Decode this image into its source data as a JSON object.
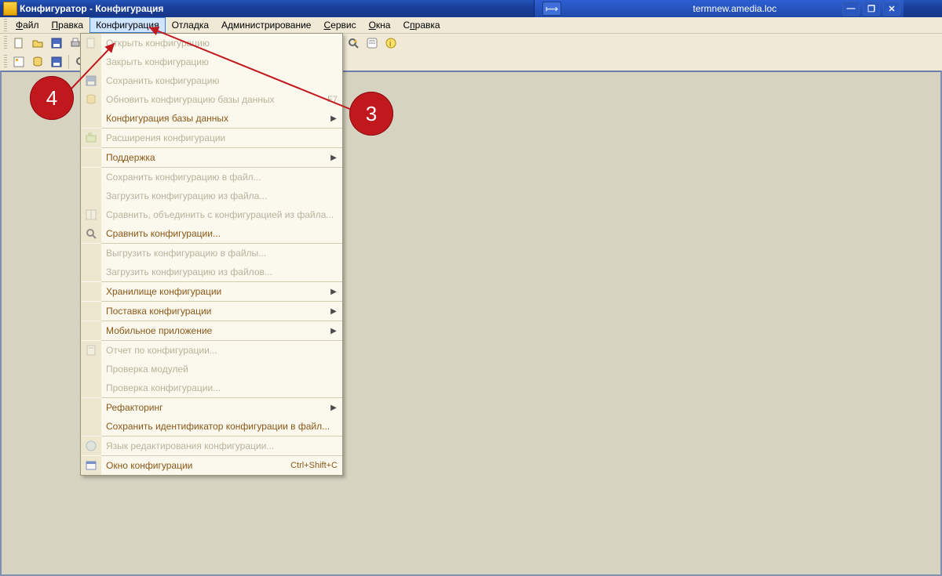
{
  "window": {
    "title": "Конфигуратор - Конфигурация",
    "remote_host": "termnew.amedia.loc"
  },
  "menubar": {
    "items": [
      {
        "label": "Файл",
        "underline": 0
      },
      {
        "label": "Правка",
        "underline": 0
      },
      {
        "label": "Конфигурация",
        "underline": -1,
        "active": true
      },
      {
        "label": "Отладка",
        "underline": -1
      },
      {
        "label": "Администрирование",
        "underline": -1
      },
      {
        "label": "Сервис",
        "underline": 0
      },
      {
        "label": "Окна",
        "underline": 0
      },
      {
        "label": "Справка",
        "underline": 1
      }
    ]
  },
  "dropdown": {
    "items": [
      {
        "label": "Открыть конфигурацию",
        "disabled": true,
        "icon": "doc"
      },
      {
        "label": "Закрыть конфигурацию",
        "disabled": true
      },
      {
        "label": "Сохранить конфигурацию",
        "disabled": true,
        "icon": "save"
      },
      {
        "label": "Обновить конфигурацию базы данных",
        "shortcut": "F7",
        "disabled": true,
        "icon": "db"
      },
      {
        "label": "Конфигурация базы данных",
        "submenu": true
      },
      {
        "sep": true
      },
      {
        "label": "Расширения конфигурации",
        "disabled": true,
        "icon": "ext"
      },
      {
        "sep": true
      },
      {
        "label": "Поддержка",
        "submenu": true
      },
      {
        "sep": true
      },
      {
        "label": "Сохранить конфигурацию в файл...",
        "disabled": true
      },
      {
        "label": "Загрузить конфигурацию из файла...",
        "disabled": true
      },
      {
        "label": "Сравнить, объединить с конфигурацией из файла...",
        "disabled": true,
        "icon": "merge"
      },
      {
        "label": "Сравнить конфигурации...",
        "icon": "compare"
      },
      {
        "sep": true
      },
      {
        "label": "Выгрузить конфигурацию в файлы...",
        "disabled": true
      },
      {
        "label": "Загрузить конфигурацию из файлов...",
        "disabled": true
      },
      {
        "sep": true
      },
      {
        "label": "Хранилище конфигурации",
        "submenu": true
      },
      {
        "sep": true
      },
      {
        "label": "Поставка конфигурации",
        "submenu": true
      },
      {
        "sep": true
      },
      {
        "label": "Мобильное приложение",
        "submenu": true
      },
      {
        "sep": true
      },
      {
        "label": "Отчет по конфигурации...",
        "disabled": true,
        "icon": "report"
      },
      {
        "label": "Проверка модулей",
        "disabled": true
      },
      {
        "label": "Проверка конфигурации...",
        "disabled": true
      },
      {
        "sep": true
      },
      {
        "label": "Рефакторинг",
        "submenu": true
      },
      {
        "label": "Сохранить идентификатор конфигурации в файл..."
      },
      {
        "sep": true
      },
      {
        "label": "Язык редактирования конфигурации...",
        "disabled": true,
        "icon": "lang"
      },
      {
        "sep": true
      },
      {
        "label": "Окно конфигурации",
        "shortcut": "Ctrl+Shift+C",
        "icon": "window"
      }
    ]
  },
  "toolbar1": {
    "icons": [
      "new",
      "open",
      "save",
      "print",
      "printpreview",
      "sep",
      "cut",
      "copy",
      "paste",
      "sep",
      "undo",
      "redo",
      "sep",
      "find",
      "sep",
      "run",
      "sep",
      "calendar",
      "syntax",
      "user",
      "debug",
      "sep",
      "magic",
      "help",
      "info"
    ]
  },
  "toolbar2": {
    "icons": [
      "cfg-open",
      "cfg-db",
      "cfg-save",
      "sep",
      "cfg-compare"
    ]
  },
  "annotations": {
    "left": "4",
    "right": "3"
  }
}
